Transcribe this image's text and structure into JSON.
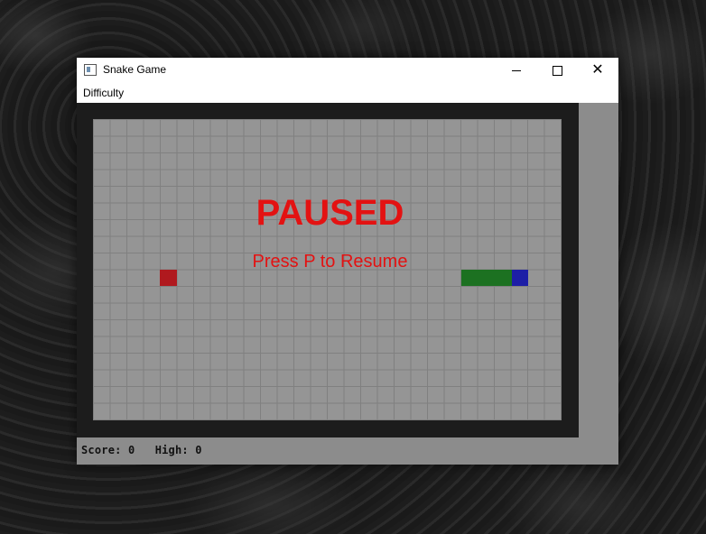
{
  "window": {
    "title": "Snake Game",
    "controls": {
      "minimize": "—",
      "maximize": "□",
      "close": "✕"
    }
  },
  "menu": {
    "items": [
      {
        "label": "Difficulty"
      }
    ]
  },
  "game": {
    "overlay": {
      "title": "PAUSED",
      "hint": "Press P to Resume"
    },
    "colors": {
      "food": "#b0191e",
      "snake_body": "#1c7121",
      "snake_head": "#1d1ea6",
      "board": "#959595",
      "text": "#e31212"
    }
  },
  "status": {
    "score_text": "Score: 0",
    "high_text": "High: 0"
  }
}
